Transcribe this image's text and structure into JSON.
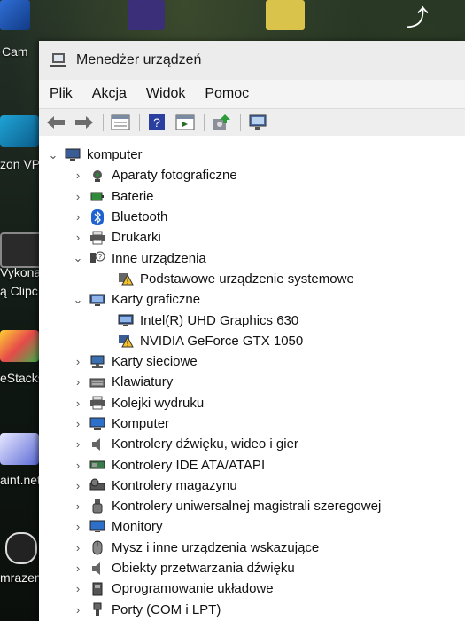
{
  "desktop": {
    "labels": [
      "Cam",
      "zon VP",
      "Vykona",
      "ą Clipc",
      "eStacks",
      "aint.net",
      "mrazem"
    ]
  },
  "window": {
    "title": "Menedżer urządzeń",
    "menu": [
      "Plik",
      "Akcja",
      "Widok",
      "Pomoc"
    ],
    "toolbar_icons": [
      "back-icon",
      "forward-icon",
      "properties-view-icon",
      "help-icon",
      "details-view-icon",
      "update-driver-icon",
      "scan-hardware-icon"
    ]
  },
  "tree": {
    "root": "komputer",
    "items": [
      {
        "label": "Aparaty fotograficzne",
        "icon": "camera-icon",
        "expanded": false
      },
      {
        "label": "Baterie",
        "icon": "battery-icon",
        "expanded": false
      },
      {
        "label": "Bluetooth",
        "icon": "bluetooth-icon",
        "expanded": false
      },
      {
        "label": "Drukarki",
        "icon": "printer-icon",
        "expanded": false
      },
      {
        "label": "Inne urządzenia",
        "icon": "unknown-device-icon",
        "expanded": true,
        "children": [
          {
            "label": "Podstawowe urządzenie systemowe",
            "icon": "warning-device-icon"
          }
        ]
      },
      {
        "label": "Karty graficzne",
        "icon": "display-adapter-icon",
        "expanded": true,
        "children": [
          {
            "label": "Intel(R) UHD Graphics 630",
            "icon": "display-adapter-icon"
          },
          {
            "label": "NVIDIA GeForce GTX 1050",
            "icon": "warning-device-icon"
          }
        ]
      },
      {
        "label": "Karty sieciowe",
        "icon": "network-adapter-icon",
        "expanded": false
      },
      {
        "label": "Klawiatury",
        "icon": "keyboard-icon",
        "expanded": false
      },
      {
        "label": "Kolejki wydruku",
        "icon": "print-queue-icon",
        "expanded": false
      },
      {
        "label": "Komputer",
        "icon": "computer-icon",
        "expanded": false
      },
      {
        "label": "Kontrolery dźwięku, wideo i gier",
        "icon": "speaker-icon",
        "expanded": false
      },
      {
        "label": "Kontrolery IDE ATA/ATAPI",
        "icon": "ide-controller-icon",
        "expanded": false
      },
      {
        "label": "Kontrolery magazynu",
        "icon": "storage-controller-icon",
        "expanded": false
      },
      {
        "label": "Kontrolery uniwersalnej magistrali szeregowej",
        "icon": "usb-icon",
        "expanded": false
      },
      {
        "label": "Monitory",
        "icon": "monitor-icon",
        "expanded": false
      },
      {
        "label": "Mysz i inne urządzenia wskazujące",
        "icon": "mouse-icon",
        "expanded": false
      },
      {
        "label": "Obiekty przetwarzania dźwięku",
        "icon": "audio-processing-icon",
        "expanded": false
      },
      {
        "label": "Oprogramowanie układowe",
        "icon": "firmware-icon",
        "expanded": false
      },
      {
        "label": "Porty (COM i LPT)",
        "icon": "port-icon",
        "expanded": false
      }
    ]
  }
}
